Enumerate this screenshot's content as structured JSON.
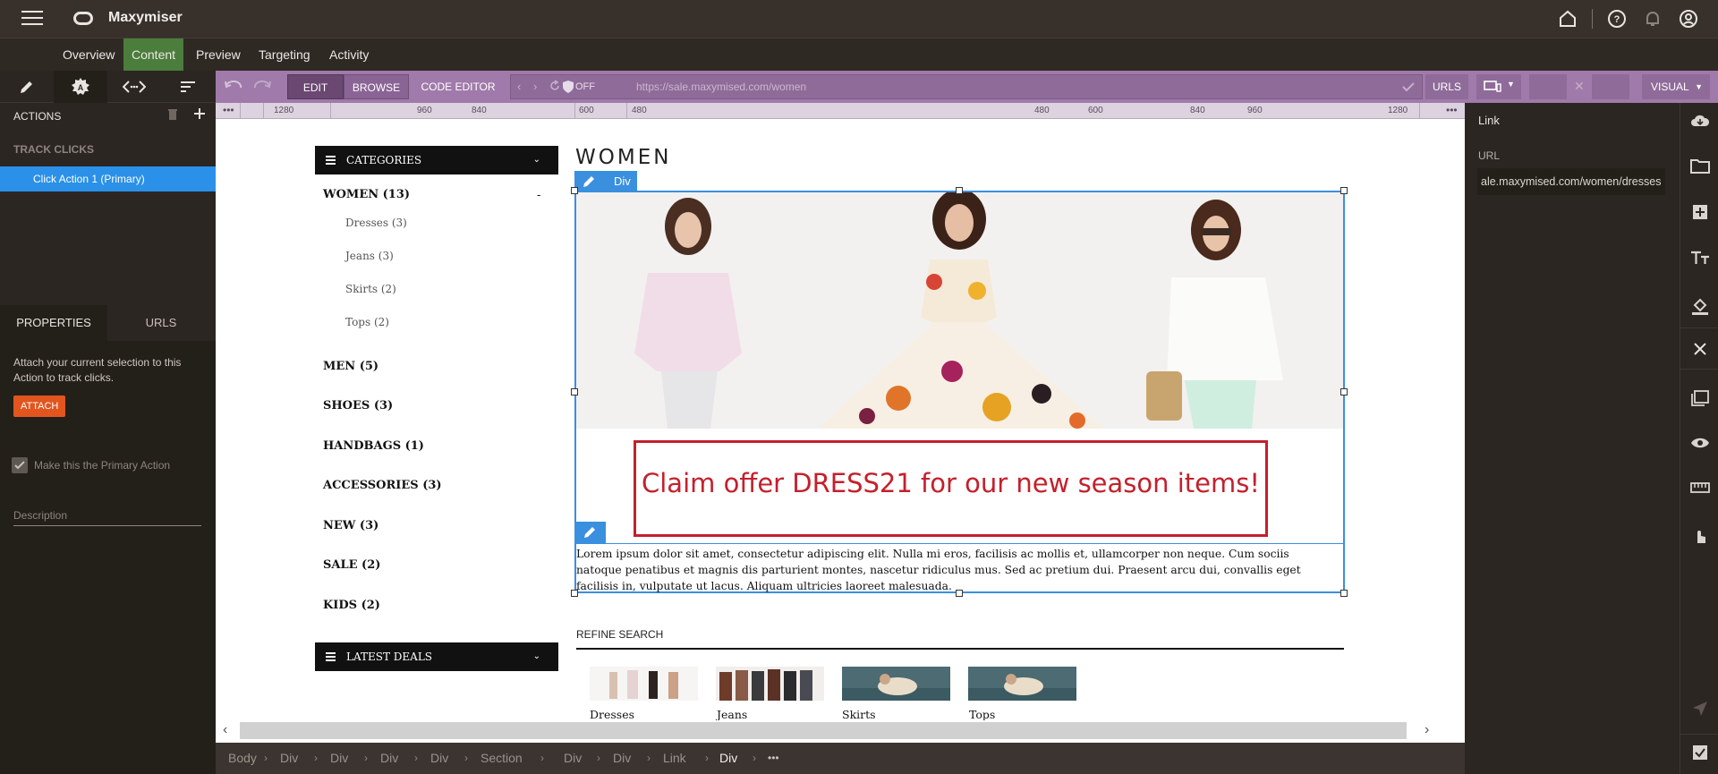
{
  "app": {
    "title": "Maxymiser"
  },
  "nav": {
    "items": [
      "Overview",
      "Content",
      "Preview",
      "Targeting",
      "Activity"
    ],
    "active": "Content"
  },
  "left": {
    "actions_label": "ACTIONS",
    "track_clicks_label": "TRACK CLICKS",
    "click_action": "Click Action 1 (Primary)",
    "tabs": [
      "PROPERTIES",
      "URLS"
    ],
    "attach_text": "Attach your current selection to this Action to track clicks.",
    "attach_button": "ATTACH",
    "primary_label": "Make this the Primary Action",
    "description_placeholder": "Description"
  },
  "toolbar": {
    "edit": "EDIT",
    "browse": "BROWSE",
    "code_editor": "CODE EDITOR",
    "off": "OFF",
    "url": "https://sale.maxymised.com/women",
    "urls": "URLS",
    "visual": "VISUAL"
  },
  "ruler": {
    "labels": [
      "1280",
      "960",
      "840",
      "600",
      "480",
      "480",
      "600",
      "840",
      "960",
      "1280"
    ]
  },
  "page": {
    "categories_title": "CATEGORIES",
    "women_cat": "WOMEN (13)",
    "women_sub": [
      "Dresses (3)",
      "Jeans (3)",
      "Skirts (2)",
      "Tops (2)"
    ],
    "collapse_glyph": "-",
    "other_cats": [
      "MEN (5)",
      "SHOES (3)",
      "HANDBAGS (1)",
      "ACCESSORIES (3)",
      "NEW (3)",
      "SALE (2)",
      "KIDS (2)"
    ],
    "latest_deals": "LATEST DEALS",
    "heading": "WOMEN",
    "div_tag": "Div",
    "offer": "Claim offer DRESS21 for our new season items!",
    "lorem": "Lorem ipsum dolor sit amet, consectetur adipiscing elit. Nulla mi eros, facilisis ac mollis et, ullamcorper non neque. Cum sociis natoque penatibus et magnis dis parturient montes, nascetur ridiculus mus. Sed ac pretium dui. Praesent arcu dui, convallis eget facilisis in, vulputate ut lacus. Aliquam ultricies laoreet malesuada.",
    "refine": "REFINE SEARCH",
    "thumbs": [
      "Dresses",
      "Jeans",
      "Skirts",
      "Tops"
    ]
  },
  "breadcrumb": [
    "Body",
    "Div",
    "Div",
    "Div",
    "Div",
    "Section",
    "Div",
    "Div",
    "Link",
    "Div"
  ],
  "right": {
    "link_label": "Link",
    "url_label": "URL",
    "url_value": "ale.maxymised.com/women/dresses"
  },
  "colors": {
    "accent": "#2a90e8",
    "nav_active": "#4b7d3c",
    "offer": "#c4202c",
    "attach": "#e2551e",
    "toolbar": "#a07aaa"
  }
}
